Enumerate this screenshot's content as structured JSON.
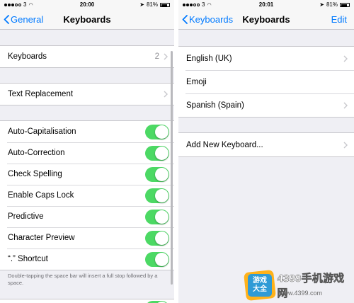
{
  "left": {
    "status": {
      "carrier": "",
      "network": "3",
      "time": "20:00",
      "battery": "81%",
      "battery_level": 0.81
    },
    "nav": {
      "back_label": "General",
      "title": "Keyboards"
    },
    "keyboards_row": {
      "label": "Keyboards",
      "detail": "2"
    },
    "text_replacement_row": {
      "label": "Text Replacement"
    },
    "toggles": [
      {
        "label": "Auto-Capitalisation",
        "on": true
      },
      {
        "label": "Auto-Correction",
        "on": true
      },
      {
        "label": "Check Spelling",
        "on": true
      },
      {
        "label": "Enable Caps Lock",
        "on": true
      },
      {
        "label": "Predictive",
        "on": true
      },
      {
        "label": "Character Preview",
        "on": true
      },
      {
        "label": "“.” Shortcut",
        "on": true
      }
    ],
    "footer": "Double-tapping the space bar will insert a full stop followed by a space."
  },
  "right": {
    "status": {
      "network": "3",
      "time": "20:01",
      "battery": "81%",
      "battery_level": 0.81
    },
    "nav": {
      "back_label": "Keyboards",
      "title": "Keyboards",
      "edit_label": "Edit"
    },
    "keyboards": [
      {
        "label": "English (UK)"
      },
      {
        "label": "Emoji"
      },
      {
        "label": "Spanish (Spain)"
      }
    ],
    "add_keyboard": {
      "label": "Add New Keyboard..."
    }
  },
  "watermark": {
    "logo_line1": "游戏",
    "logo_line2": "大全",
    "text": "4399手机游戏网",
    "url": "www.4399.com"
  },
  "colors": {
    "accent": "#007aff",
    "toggle_on": "#4cd964",
    "background": "#efeff4",
    "separator": "#c8c7cc",
    "detail": "#8e8e93"
  }
}
